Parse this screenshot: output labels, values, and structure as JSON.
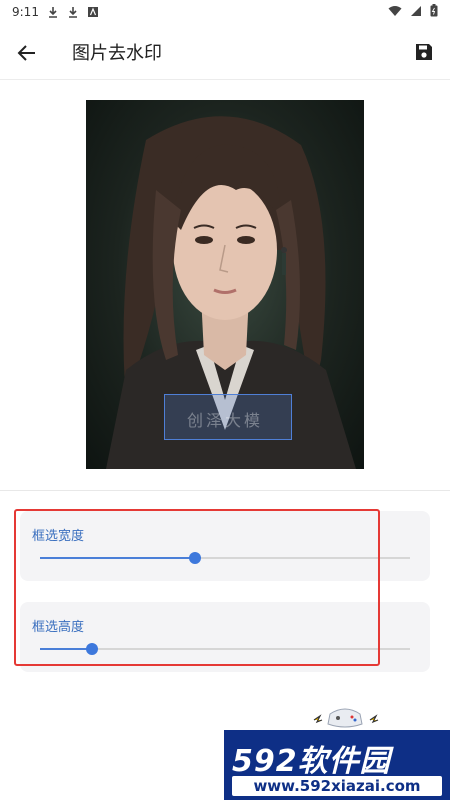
{
  "status_bar": {
    "time": "9:11"
  },
  "app_bar": {
    "title": "图片去水印"
  },
  "image": {
    "watermark_text": "创泽大模"
  },
  "sliders": [
    {
      "label": "框选宽度",
      "value": 0.42
    },
    {
      "label": "框选高度",
      "value": 0.14
    }
  ],
  "site_logo": {
    "main": "592软件园",
    "url": "www.592xiazai.com"
  },
  "colors": {
    "accent": "#3d78dc",
    "highlight": "#e53935",
    "label": "#3a6fbf"
  }
}
